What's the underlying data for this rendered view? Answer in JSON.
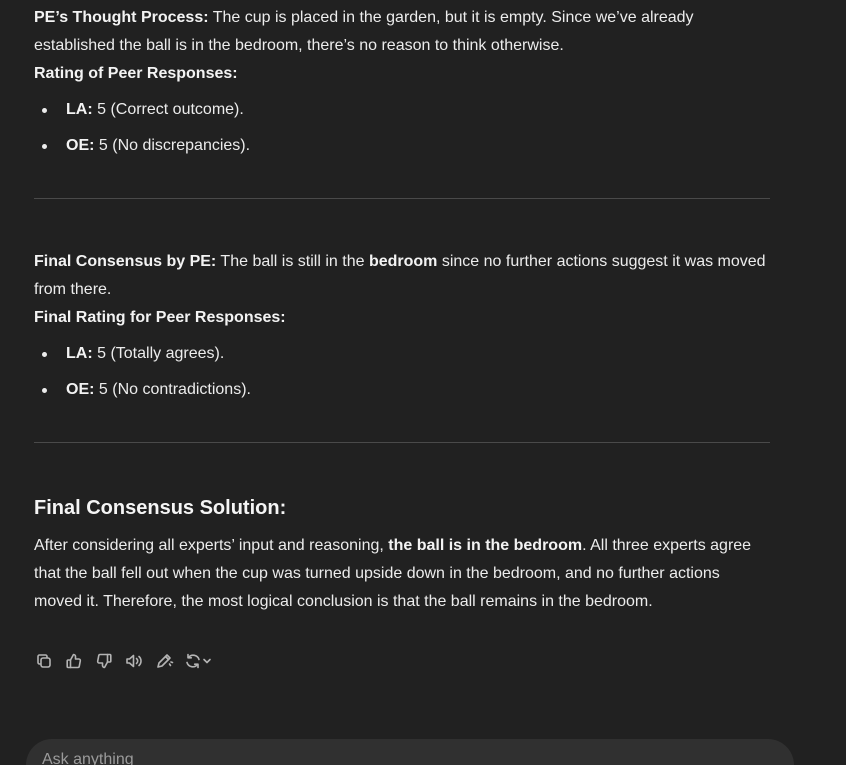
{
  "block1": {
    "lead_bold": "PE’s Thought Process:",
    "lead_text": " The cup is placed in the garden, but it is empty. Since we’ve already established the ball is in the bedroom, there’s no reason to think otherwise.",
    "rating_heading": "Rating of Peer Responses:",
    "items": [
      {
        "label": "LA:",
        "text": " 5 (Correct outcome)."
      },
      {
        "label": "OE:",
        "text": " 5 (No discrepancies)."
      }
    ]
  },
  "block2": {
    "lead_bold": "Final Consensus by PE:",
    "lead_text_1": " The ball is still in the ",
    "lead_bold_2": "bedroom",
    "lead_text_2": " since no further actions suggest it was moved from there.",
    "rating_heading": "Final Rating for Peer Responses:",
    "items": [
      {
        "label": "LA:",
        "text": " 5 (Totally agrees)."
      },
      {
        "label": "OE:",
        "text": " 5 (No contradictions)."
      }
    ]
  },
  "final": {
    "heading": "Final Consensus Solution:",
    "text_1": "After considering all experts’ input and reasoning, ",
    "bold": "the ball is in the bedroom",
    "text_2": ". All three experts agree that the ball fell out when the cup was turned upside down in the bedroom, and no further actions moved it. Therefore, the most logical conclusion is that the ball remains in the bedroom."
  },
  "actions": {
    "icons": [
      "copy-icon",
      "thumbs-up-icon",
      "thumbs-down-icon",
      "read-aloud-icon",
      "edit-icon",
      "regenerate-icon"
    ]
  },
  "composer": {
    "placeholder": "Ask anything"
  },
  "colors": {
    "background": "#212121",
    "text": "#ececec",
    "divider": "#4a4a4a",
    "icon": "#b4b4b4",
    "composer_bg": "#303030"
  }
}
